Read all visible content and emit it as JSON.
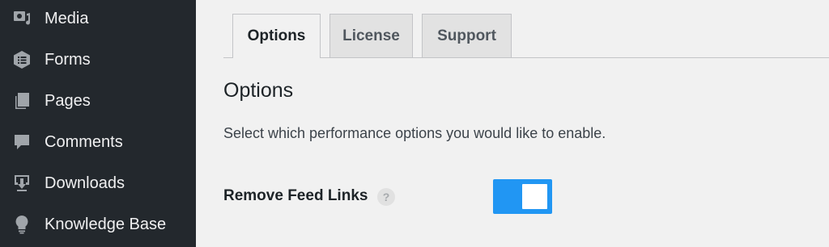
{
  "sidebar": {
    "items": [
      {
        "label": "Media",
        "icon": "media-icon"
      },
      {
        "label": "Forms",
        "icon": "forms-icon"
      },
      {
        "label": "Pages",
        "icon": "pages-icon"
      },
      {
        "label": "Comments",
        "icon": "comments-icon"
      },
      {
        "label": "Downloads",
        "icon": "downloads-icon"
      },
      {
        "label": "Knowledge Base",
        "icon": "lightbulb-icon"
      }
    ]
  },
  "tabs": [
    {
      "label": "Options",
      "active": true
    },
    {
      "label": "License",
      "active": false
    },
    {
      "label": "Support",
      "active": false
    }
  ],
  "main": {
    "heading": "Options",
    "description": "Select which performance options you would like to enable.",
    "setting": {
      "label": "Remove Feed Links",
      "help_icon": "?",
      "enabled": true
    }
  },
  "colors": {
    "sidebar_bg": "#23282d",
    "toggle_on": "#2196f3",
    "page_bg": "#f1f1f1"
  }
}
